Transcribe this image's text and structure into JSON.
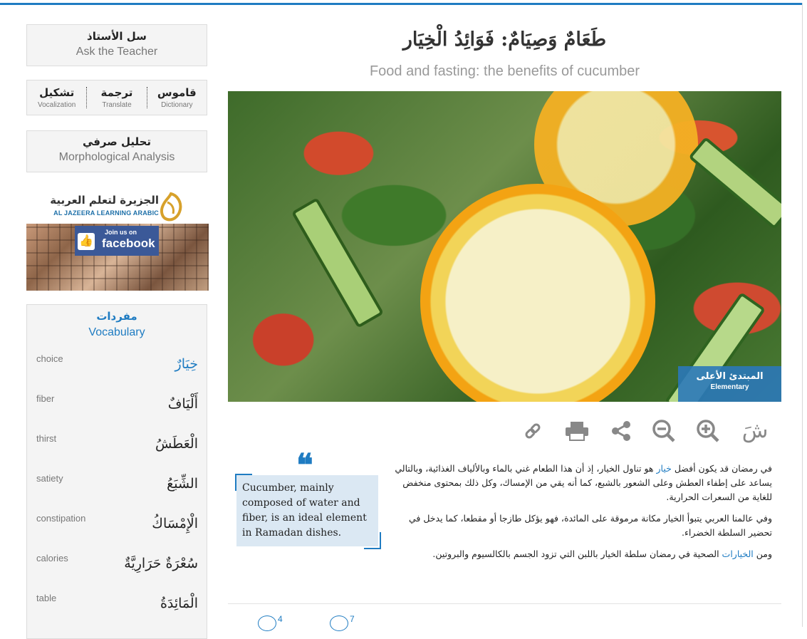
{
  "sidebar": {
    "ask": {
      "ar": "سل الأستاذ",
      "en": "Ask the Teacher"
    },
    "tools": [
      {
        "ar": "قاموس",
        "en": "Dictionary"
      },
      {
        "ar": "ترجمة",
        "en": "Translate"
      },
      {
        "ar": "تشكيل",
        "en": "Vocalization"
      }
    ],
    "morph": {
      "ar": "تحليل صرفي",
      "en": "Morphological Analysis"
    },
    "banner": {
      "brand_ar": "الجزيرة لتعلم العربية",
      "brand_en": "AL JAZEERA LEARNING ARABIC",
      "join": "Join us on",
      "fb": "facebook"
    },
    "vocab": {
      "title_ar": "مفردات",
      "title_en": "Vocabulary",
      "items": [
        {
          "en": "choice",
          "ar": "خِيَارٌ",
          "link": true
        },
        {
          "en": "fiber",
          "ar": "أَلْيَافٌ"
        },
        {
          "en": "thirst",
          "ar": "الْعَطَشُ"
        },
        {
          "en": "satiety",
          "ar": "الشِّبَعُ"
        },
        {
          "en": "constipation",
          "ar": "الْإِمْسَاكُ"
        },
        {
          "en": "calories",
          "ar": "سُعْرَةٌ حَرَارِيَّةٌ"
        },
        {
          "en": "table",
          "ar": "الْمَائِدَةُ"
        }
      ]
    }
  },
  "article": {
    "title": "طَعَامٌ وَصِيَامٌ: فَوَائِدُ الْخِيَار",
    "subtitle": "Food and fasting: the benefits of cucumber",
    "level_ar": "المبتدئ الأعلى",
    "level_en": "Elementary",
    "toolbar": {
      "font_label": "شَ"
    },
    "quote": "Cucumber, mainly composed of water and fiber, is an ideal element in Ramadan dishes.",
    "p1_a": "في رمضان قد يكون أفضل ",
    "p1_link": "خيار",
    "p1_b": " هو تناول الخيار، إذ أن هذا الطعام غني بالماء وبالألياف الغذائية، وبالتالي يساعد على إطفاء العطش وعلى الشعور بالشبع، كما أنه يقي من الإمساك، وكل ذلك بمحتوى منخفض للغاية من السعرات الحرارية.",
    "p2": "وفي عالمنا العربي يتبوأ الخيار مكانة مرموقة على المائدة، فهو يؤكل طازجا أو مقطعا، كما يدخل في تحضير السلطة الخضراء.",
    "p3_a": "ومن ",
    "p3_link": "الخيارات",
    "p3_b": " الصحية في رمضان سلطة الخيار باللبن التي تزود الجسم بالكالسيوم والبروتين."
  },
  "footer": {
    "count1": "4",
    "count2": "7"
  }
}
